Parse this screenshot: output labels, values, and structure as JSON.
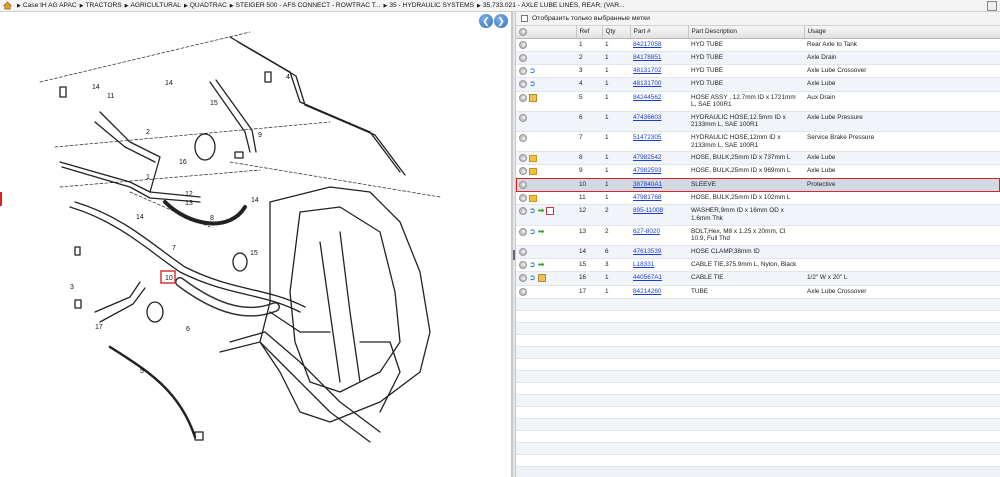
{
  "breadcrumbs": [
    "Case IH AG APAC",
    "TRACTORS",
    "AGRICULTURAL",
    "QUADTRAC",
    "STEIGER 500 - AFS CONNECT - ROWTRAC T...",
    "35 - HYDRAULIC SYSTEMS",
    "35.733.021 - AXLE LUBE LINES, REAR; (VAR..."
  ],
  "filter": {
    "label": "Отобразить только выбранные метки"
  },
  "table": {
    "headers": {
      "ref": "Ref",
      "qty": "Qty",
      "part": "Part #",
      "desc": "Part Description",
      "usage": "Usage"
    },
    "rows": [
      {
        "ref": "1",
        "qty": "1",
        "part": "84217058",
        "desc": "HYD TUBE",
        "usage": "Rear Axle to Tank",
        "icons": []
      },
      {
        "ref": "2",
        "qty": "1",
        "part": "84178851",
        "desc": "HYD TUBE",
        "usage": "Axle Drain",
        "icons": []
      },
      {
        "ref": "3",
        "qty": "1",
        "part": "48131702",
        "desc": "HYD TUBE",
        "usage": "Axle Lube Crossover",
        "icons": [
          "arrow"
        ]
      },
      {
        "ref": "4",
        "qty": "1",
        "part": "48131700",
        "desc": "HYD TUBE",
        "usage": "Axle Lube",
        "icons": [
          "arrow"
        ]
      },
      {
        "ref": "5",
        "qty": "1",
        "part": "84244562",
        "desc": "HOSE ASSY , 12.7mm ID x 1721mm L, SAE 100R1",
        "usage": "Aux Drain",
        "icons": [
          "box"
        ]
      },
      {
        "ref": "6",
        "qty": "1",
        "part": "47436603",
        "desc": "HYDRAULIC HOSE,12.5mm ID x 2133mm L, SAE 100R1",
        "usage": "Axle Lube Pressure",
        "icons": []
      },
      {
        "ref": "7",
        "qty": "1",
        "part": "51472305",
        "desc": "HYDRAULIC HOSE,12mm ID x 2133mm L, SAE 100R1",
        "usage": "Service Brake Pressure",
        "icons": []
      },
      {
        "ref": "8",
        "qty": "1",
        "part": "47982542",
        "desc": "HOSE, BULK,25mm ID x 737mm L",
        "usage": "Axle Lube",
        "icons": [
          "folder"
        ]
      },
      {
        "ref": "9",
        "qty": "1",
        "part": "47982593",
        "desc": "HOSE, BULK,25mm ID x 969mm L",
        "usage": "Axle Lube",
        "icons": [
          "folder"
        ]
      },
      {
        "ref": "10",
        "qty": "1",
        "part": "387840A1",
        "desc": "SLEEVE",
        "usage": "Protective",
        "icons": [],
        "selected": true
      },
      {
        "ref": "11",
        "qty": "1",
        "part": "47981768",
        "desc": "HOSE, BULK,25mm ID x 102mm L",
        "usage": "",
        "icons": [
          "folder"
        ]
      },
      {
        "ref": "12",
        "qty": "2",
        "part": "895-11008",
        "desc": "WASHER,9mm ID x 16mm OD x 1.6mm Thk",
        "usage": "",
        "icons": [
          "arrow",
          "green",
          "doc"
        ]
      },
      {
        "ref": "13",
        "qty": "2",
        "part": "627-8020",
        "desc": "BOLT,Hex, M8 x 1.25 x 20mm, Cl 10.9, Full Thd",
        "usage": "",
        "icons": [
          "arrow",
          "green"
        ]
      },
      {
        "ref": "14",
        "qty": "6",
        "part": "47613539",
        "desc": "HOSE CLAMP,38mm ID",
        "usage": "",
        "icons": []
      },
      {
        "ref": "15",
        "qty": "3",
        "part": "L18331",
        "desc": "CABLE TIE,375.9mm L, Nylon, Black",
        "usage": "",
        "icons": [
          "arrow",
          "green"
        ]
      },
      {
        "ref": "16",
        "qty": "1",
        "part": "440567A1",
        "desc": "CABLE TIE",
        "usage": "1/2\" W x 20\" L",
        "icons": [
          "arrow",
          "box"
        ]
      },
      {
        "ref": "17",
        "qty": "1",
        "part": "84214260",
        "desc": "TUBE",
        "usage": "Axle Lube Crossover",
        "icons": []
      }
    ]
  },
  "diagram": {
    "callouts": [
      "14",
      "11",
      "14",
      "15",
      "4",
      "2",
      "9",
      "16",
      "1",
      "12",
      "13",
      "14",
      "8",
      "14",
      "7",
      "15",
      "10",
      "3",
      "17",
      "6",
      "5"
    ]
  },
  "colors": {
    "selection_border": "#d9242a",
    "link": "#1a3fd6",
    "nav_button": "#2f6fc4"
  }
}
